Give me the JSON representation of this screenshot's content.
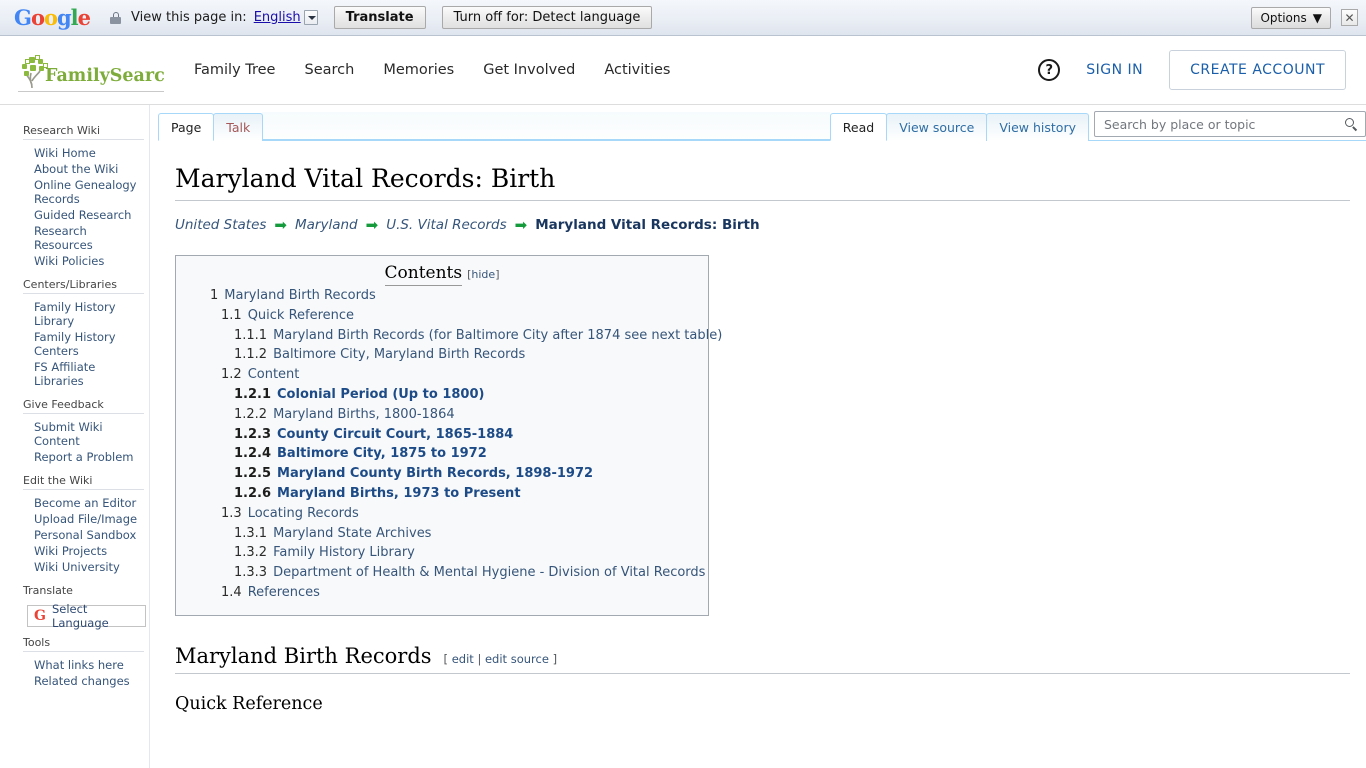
{
  "translate_bar": {
    "logo": "Google",
    "lock_icon": "lock-icon",
    "prompt": "View this page in:",
    "language": "English",
    "translate_button": "Translate",
    "turn_off_button": "Turn off for: Detect language",
    "options_button": "Options",
    "options_caret": "▼",
    "close_icon": "✕"
  },
  "header": {
    "logo_text": "FamilySearch",
    "nav": [
      {
        "label": "Family Tree"
      },
      {
        "label": "Search"
      },
      {
        "label": "Memories"
      },
      {
        "label": "Get Involved"
      },
      {
        "label": "Activities"
      }
    ],
    "help_icon": "?",
    "sign_in": "SIGN IN",
    "create_account": "CREATE ACCOUNT"
  },
  "sidebar": {
    "groups": [
      {
        "title": "Research Wiki",
        "links": [
          "Wiki Home",
          "About the Wiki",
          "Online Genealogy Records",
          "Guided Research",
          "Research Resources",
          "Wiki Policies"
        ]
      },
      {
        "title": "Centers/Libraries",
        "links": [
          "Family History Library",
          "Family History Centers",
          "FS Affiliate Libraries"
        ]
      },
      {
        "title": "Give Feedback",
        "links": [
          "Submit Wiki Content",
          "Report a Problem"
        ]
      },
      {
        "title": "Edit the Wiki",
        "links": [
          "Become an Editor",
          "Upload File/Image",
          "Personal Sandbox",
          "Wiki Projects",
          "Wiki University"
        ]
      }
    ],
    "translate_title": "Translate",
    "select_language": "Select Language",
    "tools_title": "Tools",
    "tools_links": [
      "What links here",
      "Related changes"
    ]
  },
  "tabs": {
    "left": [
      {
        "label": "Page",
        "state": "selected"
      },
      {
        "label": "Talk",
        "state": "newpage"
      }
    ],
    "right": [
      {
        "label": "Read",
        "state": "selected"
      },
      {
        "label": "View source",
        "state": "normal"
      },
      {
        "label": "View history",
        "state": "normal"
      }
    ]
  },
  "search": {
    "placeholder": "Search by place or topic",
    "value": "",
    "icon": "search-icon"
  },
  "article": {
    "title": "Maryland Vital Records: Birth",
    "breadcrumb": [
      {
        "label": "United States",
        "current": false
      },
      {
        "label": "Maryland",
        "current": false
      },
      {
        "label": "U.S. Vital Records",
        "current": false
      },
      {
        "label": "Maryland Vital Records: Birth",
        "current": true
      }
    ],
    "breadcrumb_arrow": "➡",
    "toc": {
      "title": "Contents",
      "hide_label": "hide",
      "bracket_open": "[",
      "bracket_close": "]",
      "items": [
        {
          "num": "1",
          "text": "Maryland Birth Records",
          "level": 1,
          "bold": false
        },
        {
          "num": "1.1",
          "text": "Quick Reference",
          "level": 2,
          "bold": false
        },
        {
          "num": "1.1.1",
          "text": "Maryland Birth Records (for Baltimore City after 1874 see next table)",
          "level": 3,
          "bold": false
        },
        {
          "num": "1.1.2",
          "text": "Baltimore City, Maryland Birth Records",
          "level": 3,
          "bold": false
        },
        {
          "num": "1.2",
          "text": "Content",
          "level": 2,
          "bold": false
        },
        {
          "num": "1.2.1",
          "text": "Colonial Period (Up to 1800)",
          "level": 3,
          "bold": true
        },
        {
          "num": "1.2.2",
          "text": "Maryland Births, 1800-1864",
          "level": 3,
          "bold": false
        },
        {
          "num": "1.2.3",
          "text": "County Circuit Court, 1865-1884",
          "level": 3,
          "bold": true
        },
        {
          "num": "1.2.4",
          "text": "Baltimore City, 1875 to 1972",
          "level": 3,
          "bold": true
        },
        {
          "num": "1.2.5",
          "text": "Maryland County Birth Records, 1898-1972",
          "level": 3,
          "bold": true
        },
        {
          "num": "1.2.6",
          "text": "Maryland Births, 1973 to Present",
          "level": 3,
          "bold": true
        },
        {
          "num": "1.3",
          "text": "Locating Records",
          "level": 2,
          "bold": false
        },
        {
          "num": "1.3.1",
          "text": "Maryland State Archives",
          "level": 3,
          "bold": false
        },
        {
          "num": "1.3.2",
          "text": "Family History Library",
          "level": 3,
          "bold": false
        },
        {
          "num": "1.3.3",
          "text": "Department of Health & Mental Hygiene - Division of Vital Records",
          "level": 3,
          "bold": false
        },
        {
          "num": "1.4",
          "text": "References",
          "level": 2,
          "bold": false
        }
      ]
    },
    "section_heading": "Maryland Birth Records",
    "edit_label": "edit",
    "edit_source_label": "edit source",
    "edit_sep": "|",
    "edit_open": "[",
    "edit_close": "]",
    "sub_heading": "Quick Reference"
  },
  "colors": {
    "link": "#36557a",
    "link_bold": "#1d4b87",
    "fs_green": "#7dac3a",
    "arrow_green": "#159a3c",
    "tab_border": "#a7d7f9",
    "accent_blue": "#1b5faa"
  }
}
